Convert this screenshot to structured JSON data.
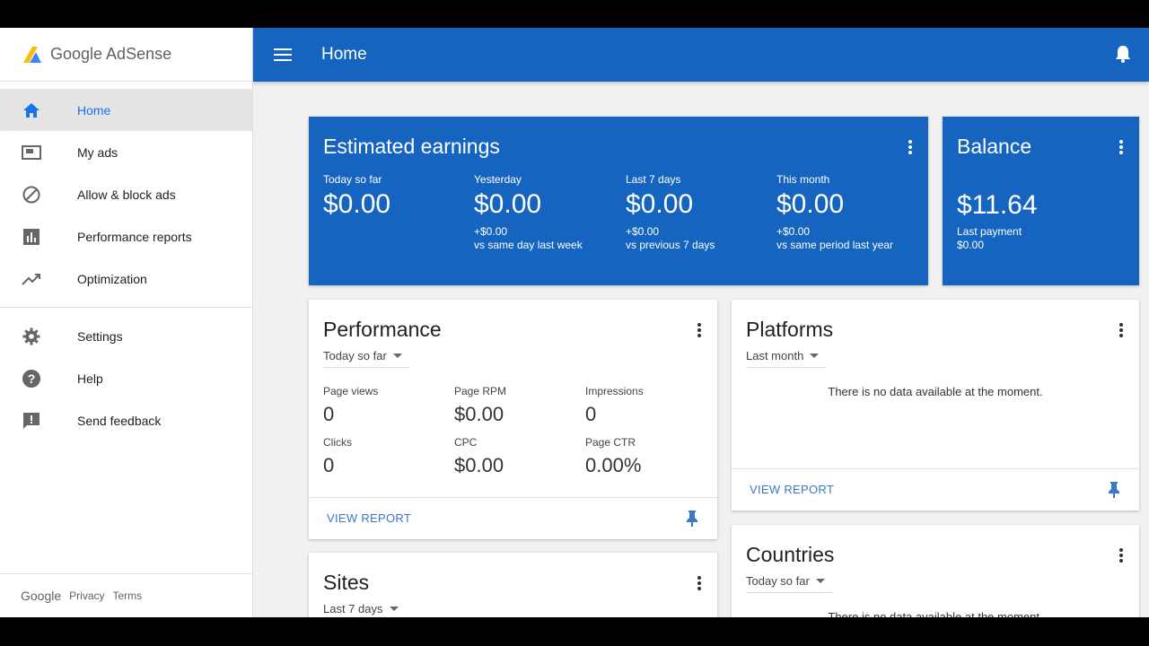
{
  "brand": {
    "name": "Google AdSense"
  },
  "topbar": {
    "title": "Home"
  },
  "sidebar": {
    "items": [
      {
        "label": "Home",
        "icon": "home-icon"
      },
      {
        "label": "My ads",
        "icon": "ad-unit-icon"
      },
      {
        "label": "Allow & block ads",
        "icon": "block-icon"
      },
      {
        "label": "Performance reports",
        "icon": "bar-chart-icon"
      },
      {
        "label": "Optimization",
        "icon": "trending-up-icon"
      },
      {
        "label": "Settings",
        "icon": "gear-icon"
      },
      {
        "label": "Help",
        "icon": "help-icon"
      },
      {
        "label": "Send feedback",
        "icon": "feedback-icon"
      }
    ],
    "footer": {
      "google": "Google",
      "privacy": "Privacy",
      "terms": "Terms"
    }
  },
  "earnings": {
    "title": "Estimated earnings",
    "columns": [
      {
        "label": "Today so far",
        "value": "$0.00",
        "delta": "",
        "comparison": ""
      },
      {
        "label": "Yesterday",
        "value": "$0.00",
        "delta": "+$0.00",
        "comparison": "vs same day last week"
      },
      {
        "label": "Last 7 days",
        "value": "$0.00",
        "delta": "+$0.00",
        "comparison": "vs previous 7 days"
      },
      {
        "label": "This month",
        "value": "$0.00",
        "delta": "+$0.00",
        "comparison": "vs same period last year"
      }
    ]
  },
  "balance": {
    "title": "Balance",
    "value": "$11.64",
    "last_payment_label": "Last payment",
    "last_payment_value": "$0.00"
  },
  "performance": {
    "title": "Performance",
    "range": "Today so far",
    "metrics": [
      {
        "label": "Page views",
        "value": "0"
      },
      {
        "label": "Page RPM",
        "value": "$0.00"
      },
      {
        "label": "Impressions",
        "value": "0"
      },
      {
        "label": "Clicks",
        "value": "0"
      },
      {
        "label": "CPC",
        "value": "$0.00"
      },
      {
        "label": "Page CTR",
        "value": "0.00%"
      }
    ],
    "view_report": "VIEW REPORT"
  },
  "platforms": {
    "title": "Platforms",
    "range": "Last month",
    "empty": "There is no data available at the moment.",
    "view_report": "VIEW REPORT"
  },
  "sites": {
    "title": "Sites",
    "range": "Last 7 days"
  },
  "countries": {
    "title": "Countries",
    "range": "Today so far",
    "empty": "There is no data available at the moment."
  },
  "colors": {
    "primary": "#1565c0",
    "link": "#3b78c4",
    "active_nav": "#1a73e8"
  }
}
